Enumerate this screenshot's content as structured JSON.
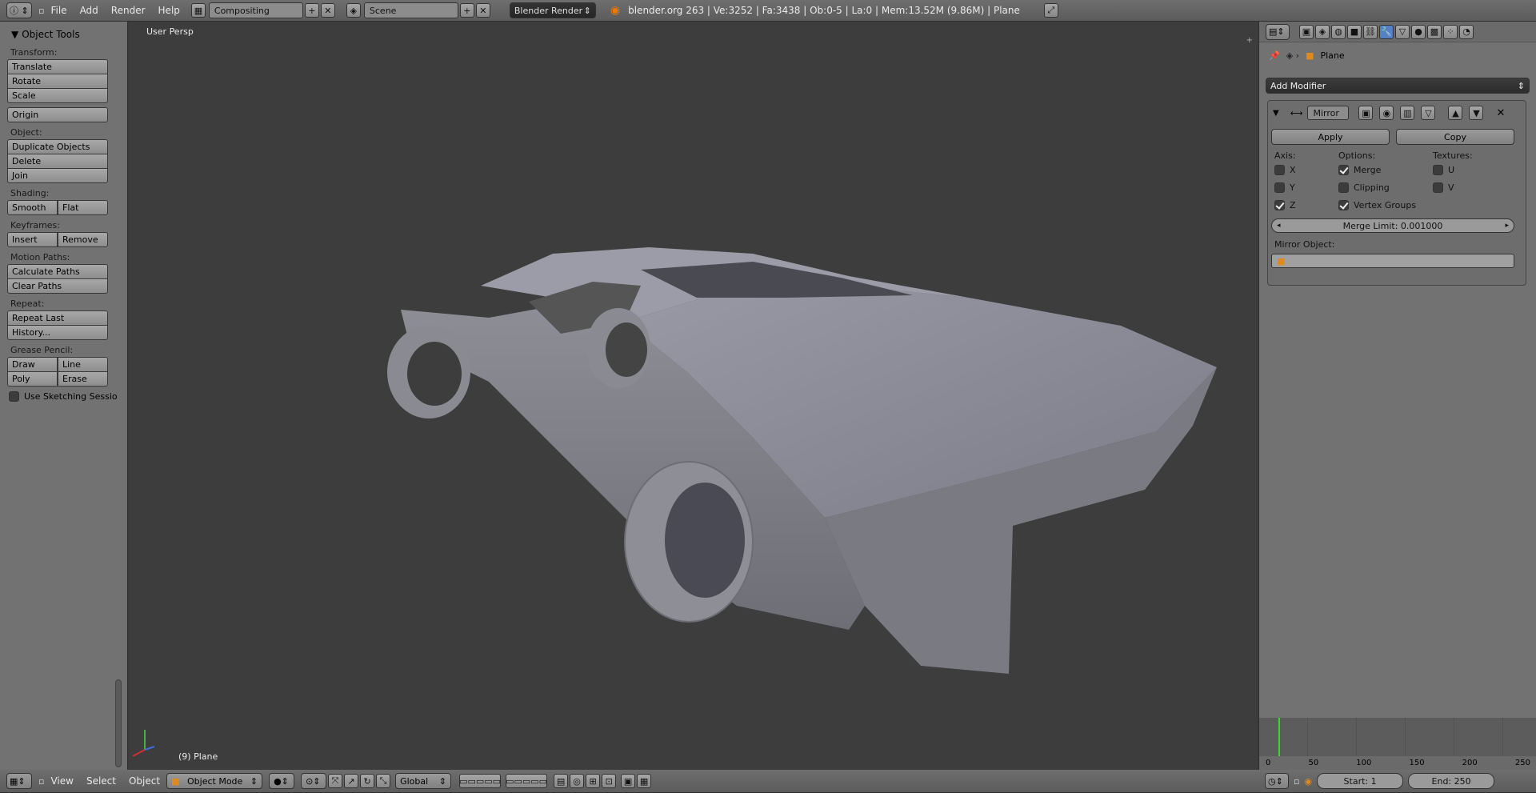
{
  "topbar": {
    "menus": [
      "File",
      "Add",
      "Render",
      "Help"
    ],
    "screen_layout": "Compositing",
    "scene": "Scene",
    "render_engine": "Blender Render",
    "stats": "blender.org 263 | Ve:3252 | Fa:3438 | Ob:0-5 | La:0 | Mem:13.52M (9.86M) | Plane"
  },
  "tool_panel": {
    "header": "Object Tools",
    "transform_label": "Transform:",
    "translate": "Translate",
    "rotate": "Rotate",
    "scale": "Scale",
    "origin": "Origin",
    "object_label": "Object:",
    "duplicate": "Duplicate Objects",
    "delete": "Delete",
    "join": "Join",
    "shading_label": "Shading:",
    "smooth": "Smooth",
    "flat": "Flat",
    "keyframes_label": "Keyframes:",
    "insert": "Insert",
    "remove": "Remove",
    "motion_label": "Motion Paths:",
    "calc_paths": "Calculate Paths",
    "clear_paths": "Clear Paths",
    "repeat_label": "Repeat:",
    "repeat_last": "Repeat Last",
    "history": "History...",
    "grease_label": "Grease Pencil:",
    "draw": "Draw",
    "line": "Line",
    "poly": "Poly",
    "erase": "Erase",
    "sketching": "Use Sketching Sessio"
  },
  "viewport": {
    "view_name": "User Persp",
    "object_label": "(9) Plane"
  },
  "properties": {
    "object_name": "Plane",
    "add_modifier": "Add Modifier",
    "modifier_name": "Mirror",
    "apply": "Apply",
    "copy": "Copy",
    "axis_label": "Axis:",
    "options_label": "Options:",
    "textures_label": "Textures:",
    "x": "X",
    "y": "Y",
    "z": "Z",
    "merge": "Merge",
    "clipping": "Clipping",
    "vertex_groups": "Vertex Groups",
    "u": "U",
    "v": "V",
    "merge_limit": "Merge Limit: 0.001000",
    "mirror_object_label": "Mirror Object:"
  },
  "timeline": {
    "ticks": [
      "0",
      "50",
      "100",
      "150",
      "200",
      "250"
    ],
    "start": "Start: 1",
    "end": "End: 250"
  },
  "bottombar": {
    "menus": [
      "View",
      "Select",
      "Object"
    ],
    "mode": "Object Mode",
    "orientation": "Global"
  }
}
